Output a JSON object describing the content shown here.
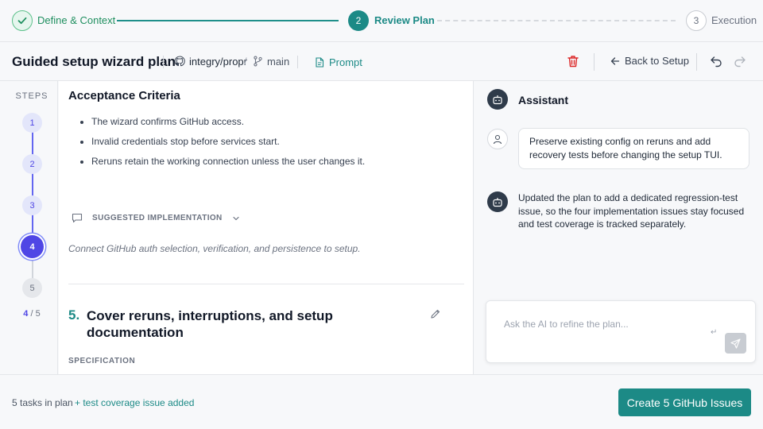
{
  "stepper": {
    "steps": [
      {
        "number": "1",
        "label": "Define & Context",
        "status": "complete"
      },
      {
        "number": "2",
        "label": "Review Plan",
        "status": "current"
      },
      {
        "number": "3",
        "label": "Execution",
        "status": "upcoming"
      }
    ]
  },
  "header": {
    "title": "Guided setup wizard plan",
    "repo": "integry/propr",
    "separator": "/",
    "branch": "main",
    "prompt_label": "Prompt",
    "back_label": "Back to Setup"
  },
  "rail": {
    "title": "STEPS",
    "nodes": [
      "1",
      "2",
      "3",
      "4",
      "5"
    ],
    "current": "4",
    "separator": "/",
    "total": "5"
  },
  "content": {
    "acceptance_title": "Acceptance Criteria",
    "acceptance_items": [
      "The wizard confirms GitHub access.",
      "Invalid credentials stop before services start.",
      "Reruns retain the working connection unless the user changes it."
    ],
    "suggested_label": "SUGGESTED IMPLEMENTATION",
    "suggested_text": "Connect GitHub auth selection, verification, and persistence to setup.",
    "task_number": "5.",
    "task_title": "Cover reruns, interruptions, and setup documentation",
    "spec_label": "SPECIFICATION"
  },
  "assistant": {
    "title": "Assistant",
    "user_message": "Preserve existing config on reruns and add recovery tests before changing the setup TUI.",
    "bot_message": "Updated the plan to add a dedicated regression-test issue, so the four implementation issues stay focused and test coverage is tracked separately.",
    "input_placeholder": "Ask the AI to refine the plan...",
    "enter_hint": "↵"
  },
  "footer": {
    "task_count": "5 tasks in plan",
    "added_note": "+ test coverage issue added",
    "create_label": "Create 5 GitHub Issues"
  },
  "colors": {
    "accent": "#1c8a86",
    "rail_accent": "#4f46e5",
    "danger": "#dc2626",
    "complete": "#1f8f5f"
  }
}
